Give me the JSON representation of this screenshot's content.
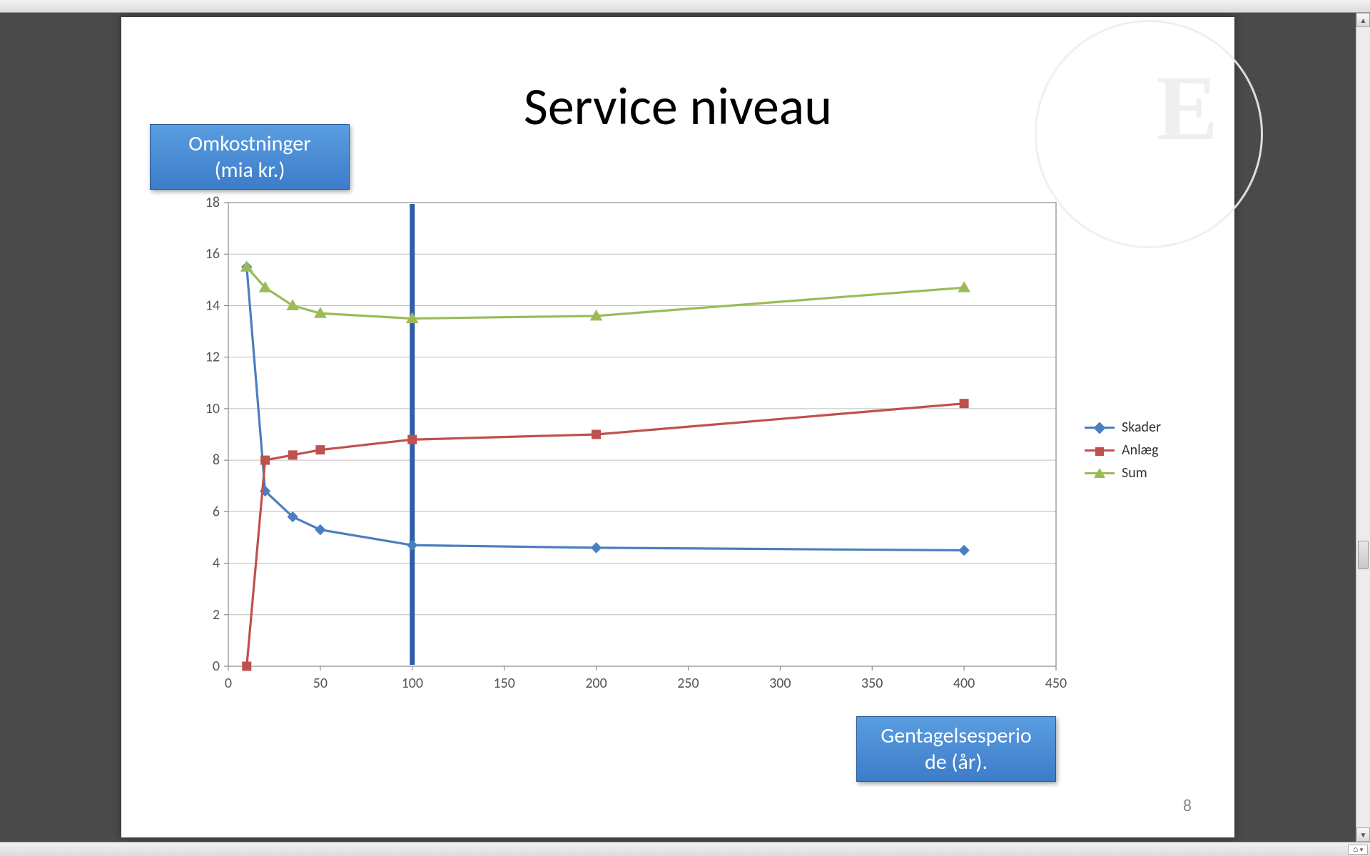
{
  "slide": {
    "title": "Service niveau",
    "y_axis_label_line1": "Omkostninger",
    "y_axis_label_line2": "(mia kr.)",
    "x_axis_label_line1": "Gentagelsesperio",
    "x_axis_label_line2": "de (år).",
    "page_number": "8",
    "watermark_letter": "E"
  },
  "legend": {
    "skader": "Skader",
    "anlaeg": "Anlæg",
    "sum": "Sum"
  },
  "chart_data": {
    "type": "line",
    "xlabel": "Gentagelsesperiode (år).",
    "ylabel": "Omkostninger (mia kr.)",
    "xlim": [
      0,
      450
    ],
    "ylim": [
      0,
      18
    ],
    "x_ticks": [
      0,
      50,
      100,
      150,
      200,
      250,
      300,
      350,
      400,
      450
    ],
    "y_ticks": [
      0,
      2,
      4,
      6,
      8,
      10,
      12,
      14,
      16,
      18
    ],
    "x": [
      10,
      20,
      35,
      50,
      100,
      200,
      400
    ],
    "series": [
      {
        "name": "Skader",
        "color": "#4a7fbf",
        "marker": "diamond",
        "values": [
          15.5,
          6.8,
          5.8,
          5.3,
          4.7,
          4.6,
          4.5
        ]
      },
      {
        "name": "Anlæg",
        "color": "#c0504d",
        "marker": "square",
        "values": [
          0.0,
          8.0,
          8.2,
          8.4,
          8.8,
          9.0,
          10.2
        ]
      },
      {
        "name": "Sum",
        "color": "#9bbb59",
        "marker": "triangle",
        "values": [
          15.5,
          14.7,
          14.0,
          13.7,
          13.5,
          13.6,
          14.7
        ]
      }
    ],
    "annotations": {
      "vertical_line_x": 100,
      "vertical_line_color": "#2f5ea8",
      "plot_area_border": true
    }
  }
}
